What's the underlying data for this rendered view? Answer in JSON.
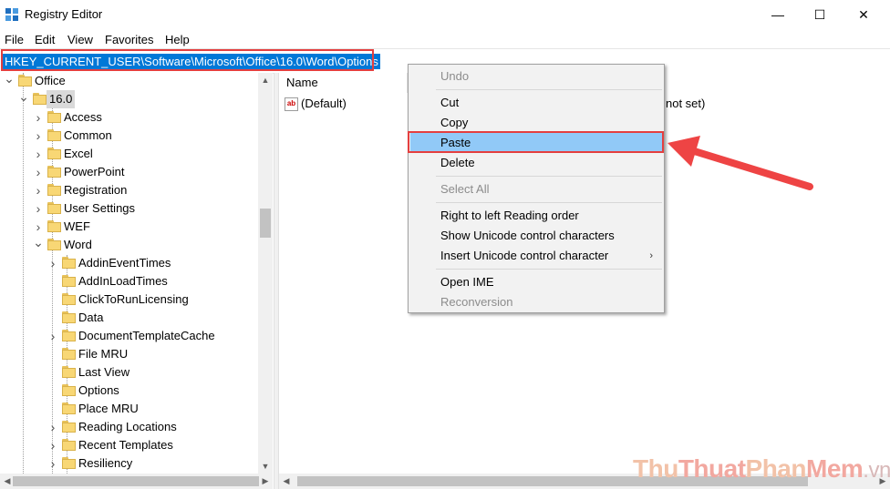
{
  "window": {
    "title": "Registry Editor",
    "minimize_glyph": "—",
    "maximize_glyph": "☐",
    "close_glyph": "✕"
  },
  "menu": [
    "File",
    "Edit",
    "View",
    "Favorites",
    "Help"
  ],
  "address": {
    "path": "HKEY_CURRENT_USER\\Software\\Microsoft\\Office\\16.0\\Word\\Options"
  },
  "tree": [
    {
      "label": "Office",
      "level": 1,
      "expanded": true
    },
    {
      "label": "16.0",
      "level": 2,
      "expanded": true,
      "selected": true
    },
    {
      "label": "Access",
      "level": 3,
      "expandable": true
    },
    {
      "label": "Common",
      "level": 3,
      "expandable": true
    },
    {
      "label": "Excel",
      "level": 3,
      "expandable": true
    },
    {
      "label": "PowerPoint",
      "level": 3,
      "expandable": true
    },
    {
      "label": "Registration",
      "level": 3,
      "expandable": true
    },
    {
      "label": "User Settings",
      "level": 3,
      "expandable": true
    },
    {
      "label": "WEF",
      "level": 3,
      "expandable": true
    },
    {
      "label": "Word",
      "level": 3,
      "expanded": true
    },
    {
      "label": "AddinEventTimes",
      "level": 4,
      "expandable": true
    },
    {
      "label": "AddInLoadTimes",
      "level": 4,
      "expandable": false
    },
    {
      "label": "ClickToRunLicensing",
      "level": 4,
      "expandable": false
    },
    {
      "label": "Data",
      "level": 4,
      "expandable": false
    },
    {
      "label": "DocumentTemplateCache",
      "level": 4,
      "expandable": true
    },
    {
      "label": "File MRU",
      "level": 4,
      "expandable": false
    },
    {
      "label": "Last View",
      "level": 4,
      "expandable": false
    },
    {
      "label": "Options",
      "level": 4,
      "expandable": false
    },
    {
      "label": "Place MRU",
      "level": 4,
      "expandable": false
    },
    {
      "label": "Reading Locations",
      "level": 4,
      "expandable": true
    },
    {
      "label": "Recent Templates",
      "level": 4,
      "expandable": true
    },
    {
      "label": "Resiliency",
      "level": 4,
      "expandable": true
    }
  ],
  "values_pane": {
    "column_name": "Name",
    "rows": [
      {
        "name": "(Default)",
        "data_fragment": "not set)"
      }
    ]
  },
  "context_menu": {
    "items": [
      {
        "label": "Undo",
        "disabled": true
      },
      {
        "sep": true
      },
      {
        "label": "Cut"
      },
      {
        "label": "Copy"
      },
      {
        "label": "Paste",
        "hover": true
      },
      {
        "label": "Delete"
      },
      {
        "sep": true
      },
      {
        "label": "Select All",
        "disabled": true
      },
      {
        "sep": true
      },
      {
        "label": "Right to left Reading order"
      },
      {
        "label": "Show Unicode control characters"
      },
      {
        "label": "Insert Unicode control character",
        "submenu": true
      },
      {
        "sep": true
      },
      {
        "label": "Open IME"
      },
      {
        "label": "Reconversion",
        "disabled": true
      }
    ]
  },
  "watermark": {
    "part1": "Thu",
    "part2": "Thuat",
    "part3": "Phan",
    "part4": "Mem",
    "part5": ".vn"
  },
  "colors": {
    "selection_blue": "#0078d7",
    "menu_hover": "#91c9f7",
    "highlight_red": "#e43f3f",
    "arrow_red": "#ee4444"
  }
}
